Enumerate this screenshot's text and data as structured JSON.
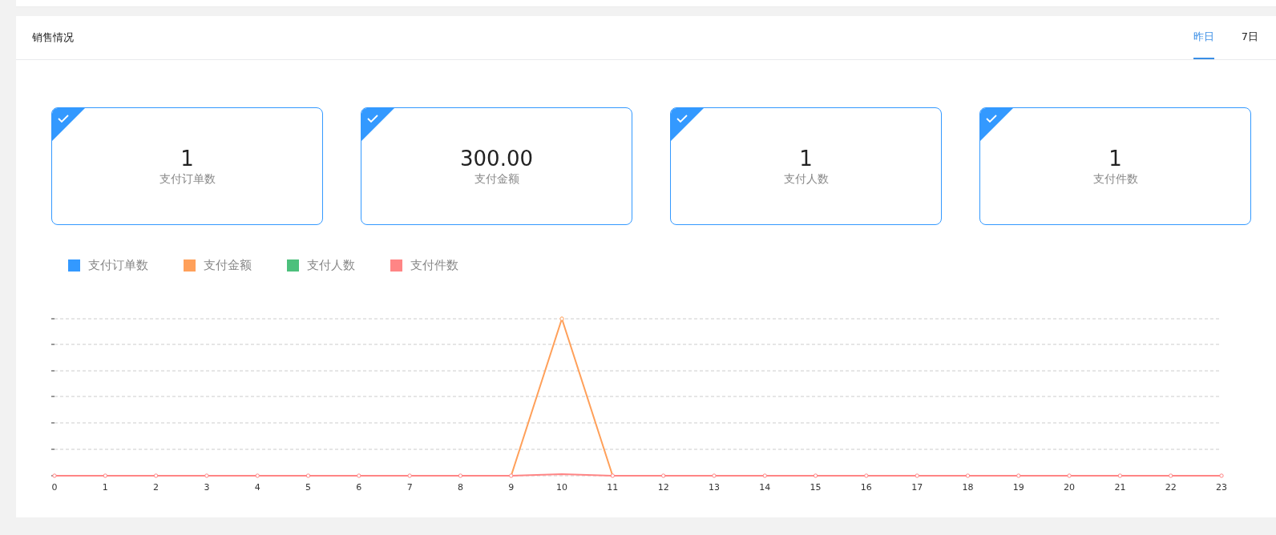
{
  "panel": {
    "title": "销售情况",
    "tabs": [
      {
        "label": "昨日",
        "selected": true
      },
      {
        "label": "7日",
        "selected": false
      }
    ]
  },
  "metrics": [
    {
      "value": "1",
      "label": "支付订单数",
      "selected": true
    },
    {
      "value": "300.00",
      "label": "支付金额",
      "selected": true
    },
    {
      "value": "1",
      "label": "支付人数",
      "selected": true
    },
    {
      "value": "1",
      "label": "支付件数",
      "selected": true
    }
  ],
  "legend": [
    {
      "label": "支付订单数",
      "color": "#3399ff"
    },
    {
      "label": "支付金额",
      "color": "#ffa05a"
    },
    {
      "label": "支付人数",
      "color": "#4cc07c"
    },
    {
      "label": "支付件数",
      "color": "#ff8585"
    }
  ],
  "chart": {
    "x_labels": [
      "0",
      "1",
      "2",
      "3",
      "4",
      "5",
      "6",
      "7",
      "8",
      "9",
      "10",
      "11",
      "12",
      "13",
      "14",
      "15",
      "16",
      "17",
      "18",
      "19",
      "20",
      "21",
      "22",
      "23"
    ]
  }
}
